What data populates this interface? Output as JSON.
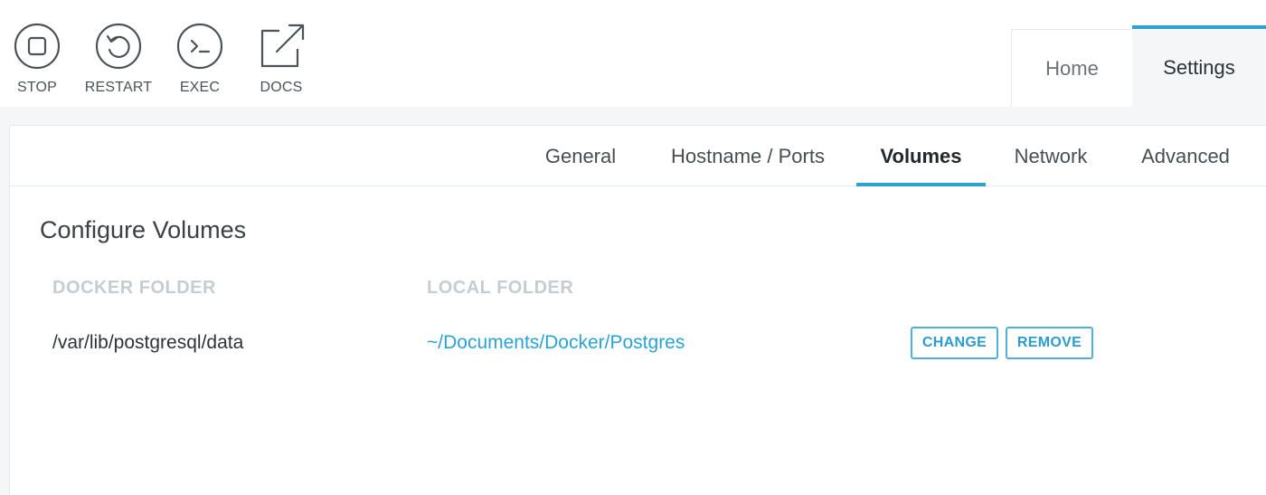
{
  "toolbar": {
    "buttons": [
      {
        "label": "STOP",
        "icon": "stop-icon"
      },
      {
        "label": "RESTART",
        "icon": "restart-icon"
      },
      {
        "label": "EXEC",
        "icon": "terminal-icon"
      },
      {
        "label": "DOCS",
        "icon": "external-link-icon"
      }
    ]
  },
  "main_tabs": {
    "home": "Home",
    "settings": "Settings",
    "active": "Settings"
  },
  "settings_tabs": {
    "items": [
      "General",
      "Hostname / Ports",
      "Volumes",
      "Network",
      "Advanced"
    ],
    "active": "Volumes"
  },
  "volumes": {
    "title": "Configure Volumes",
    "columns": {
      "docker": "DOCKER FOLDER",
      "local": "LOCAL FOLDER"
    },
    "rows": [
      {
        "docker_folder": "/var/lib/postgresql/data",
        "local_folder": "~/Documents/Docker/Postgres",
        "change_label": "CHANGE",
        "remove_label": "REMOVE"
      }
    ]
  },
  "colors": {
    "accent": "#2fa1cf",
    "link": "#2aa2d4",
    "muted_header": "#c6cdd2"
  }
}
